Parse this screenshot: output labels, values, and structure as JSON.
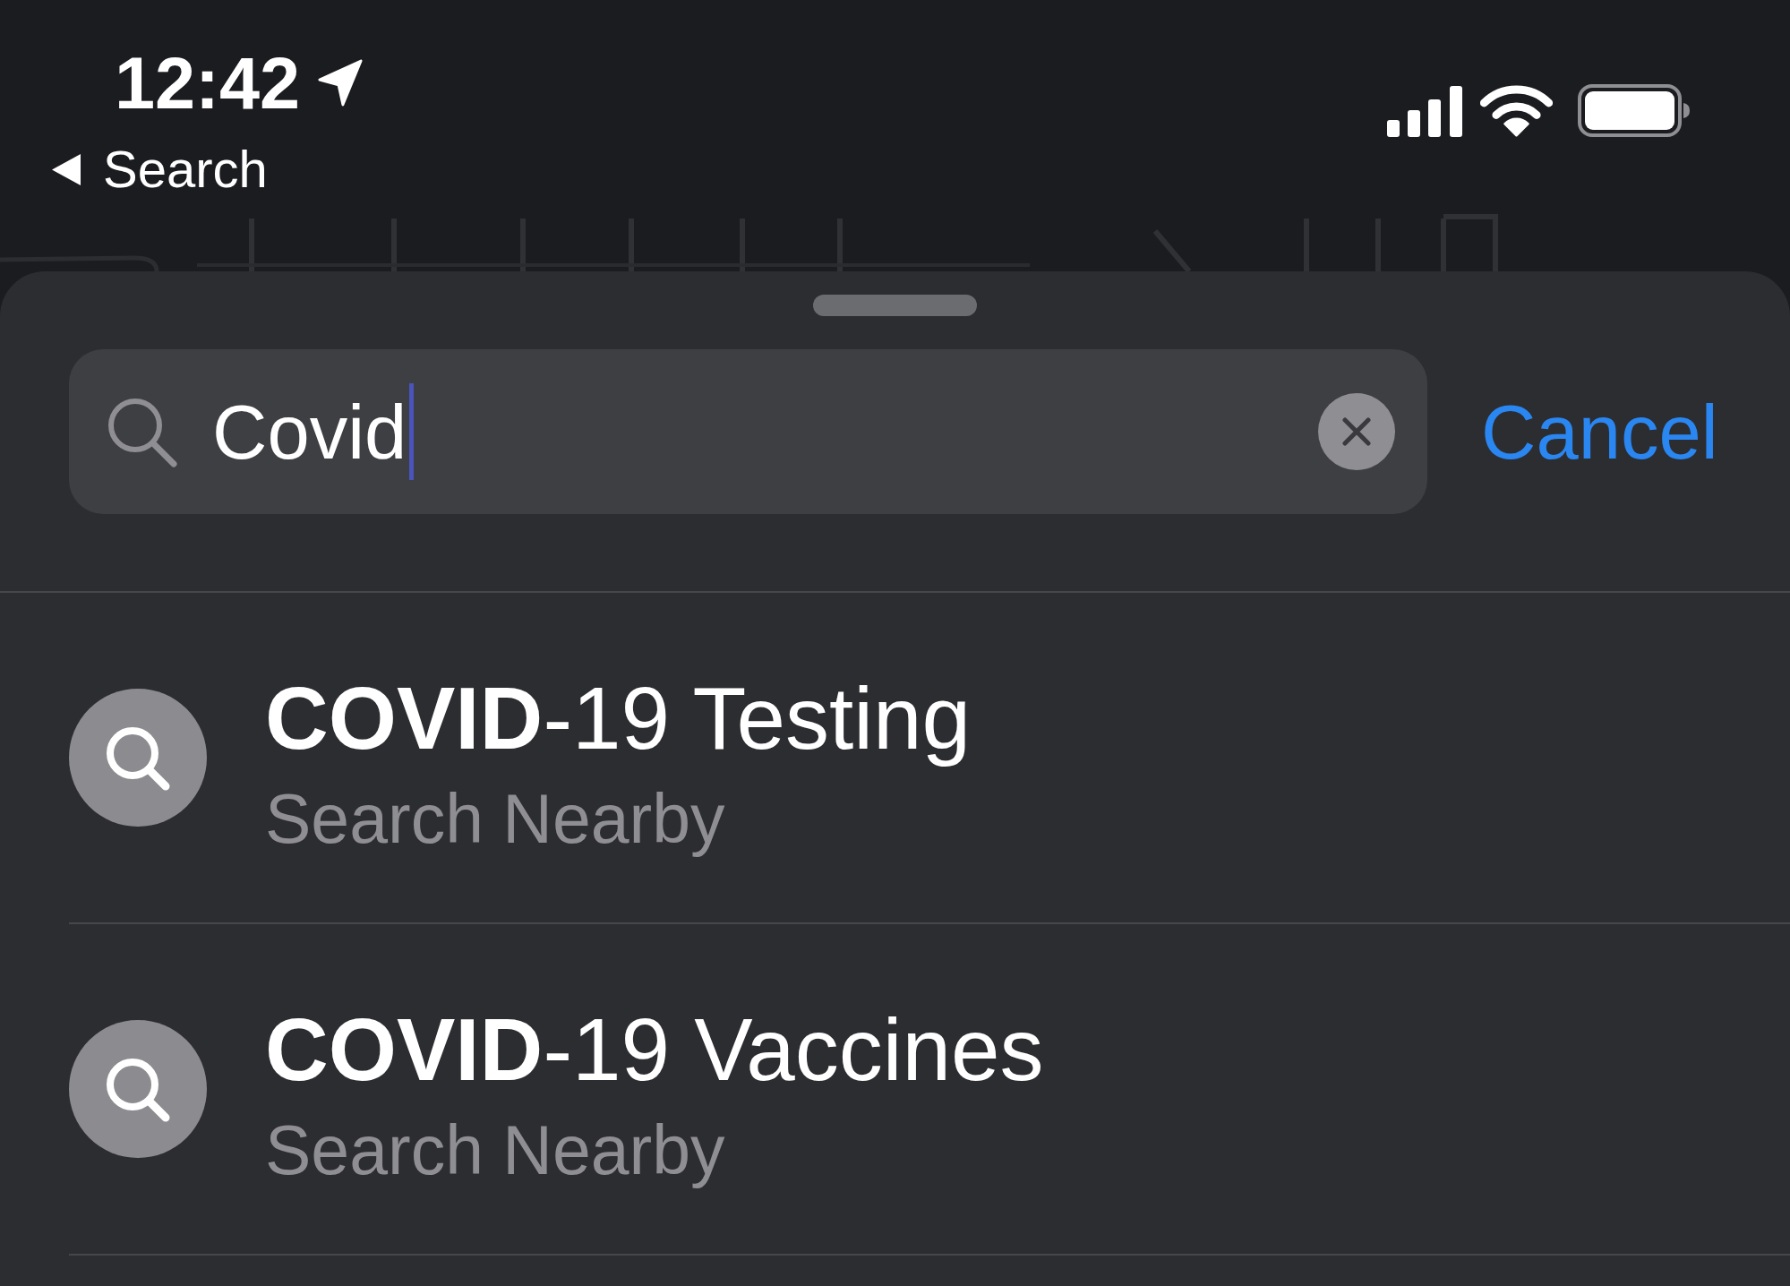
{
  "status_bar": {
    "time": "12:42",
    "back_link": {
      "label": "Search"
    }
  },
  "sheet": {
    "search_field": {
      "value": "Covid",
      "focused": true
    },
    "cancel_button": {
      "label": "Cancel"
    },
    "results": [
      {
        "title": "**COVID**-19 Testing",
        "subtitle": "Search Nearby"
      },
      {
        "title": "**COVID**-19 Vaccines",
        "subtitle": "Search Nearby"
      }
    ]
  }
}
